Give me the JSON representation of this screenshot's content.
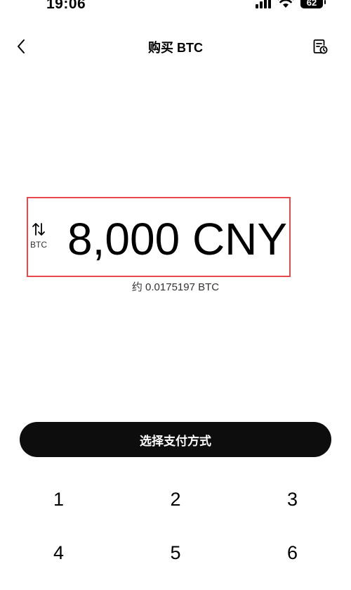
{
  "status_bar": {
    "time": "19:06",
    "battery": "62"
  },
  "header": {
    "title": "购买 BTC",
    "back_icon": "chevron-left-icon",
    "history_icon": "order-history-icon"
  },
  "amount": {
    "swap_unit_label": "BTC",
    "value": "8,000 CNY",
    "conversion": "约 0.0175197 BTC",
    "highlight_color": "#e8484a"
  },
  "actions": {
    "pay_button_label": "选择支付方式"
  },
  "keypad": {
    "keys": [
      "1",
      "2",
      "3",
      "4",
      "5",
      "6"
    ]
  }
}
